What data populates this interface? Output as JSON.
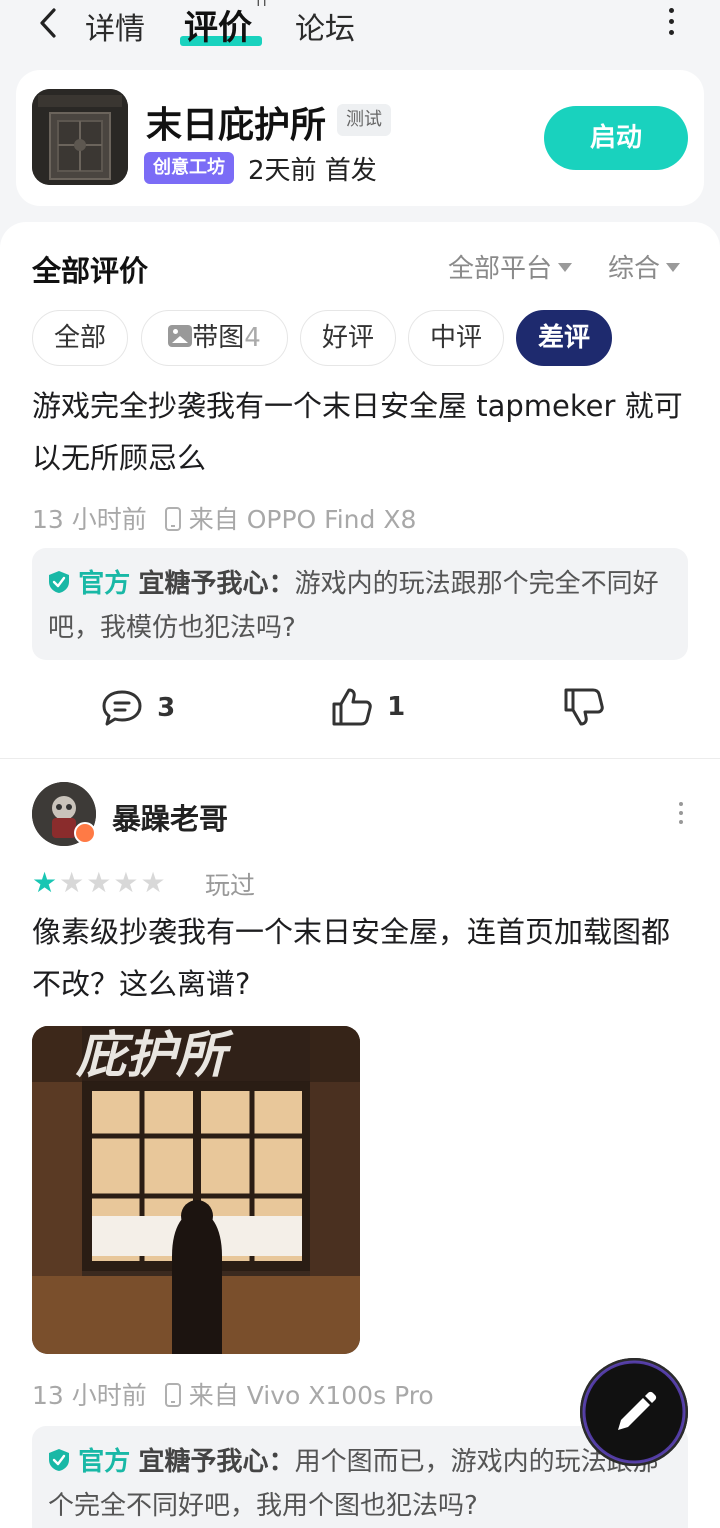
{
  "nav": {
    "tabs": [
      {
        "label": "详情"
      },
      {
        "label": "评价"
      },
      {
        "label": "论坛"
      }
    ],
    "active_sup": "††"
  },
  "app": {
    "name": "末日庇护所",
    "tag_test": "测试",
    "tag_workshop": "创意工坊",
    "release": "2天前 首发",
    "launch_label": "启动",
    "accent": "#19d2be"
  },
  "reviews_panel": {
    "title": "全部评价",
    "platform_filter": "全部平台",
    "sort_filter": "综合",
    "chips": {
      "all": "全部",
      "with_image": "带图",
      "with_image_count": "4",
      "good": "好评",
      "mid": "中评",
      "bad": "差评"
    }
  },
  "review1": {
    "text": "游戏完全抄袭我有一个末日安全屋 tapmeker 就可以无所顾忌么",
    "time": "13 小时前",
    "device": "来自 OPPO Find X8",
    "reply": {
      "label": "官方",
      "user": "宜糖予我心",
      "text": "游戏内的玩法跟那个完全不同好吧，我模仿也犯法吗?"
    },
    "comments": "3",
    "likes": "1"
  },
  "review2": {
    "username": "暴躁老哥",
    "rating": 1,
    "played": "玩过",
    "text": "像素级抄袭我有一个末日安全屋，连首页加载图都不改？这么离谱?",
    "image_title": "庇护所",
    "time": "13 小时前",
    "device": "来自 Vivo X100s Pro",
    "reply": {
      "label": "官方",
      "user": "宜糖予我心",
      "text": "用个图而已，游戏内的玩法跟那个完全不同好吧，我用个图也犯法吗?"
    }
  },
  "icons": [
    "back-icon",
    "more-vertical-icon",
    "image-icon",
    "comment-icon",
    "thumbs-up-icon",
    "thumbs-down-icon",
    "official-shield-icon",
    "phone-icon",
    "star-icon",
    "pen-icon"
  ]
}
